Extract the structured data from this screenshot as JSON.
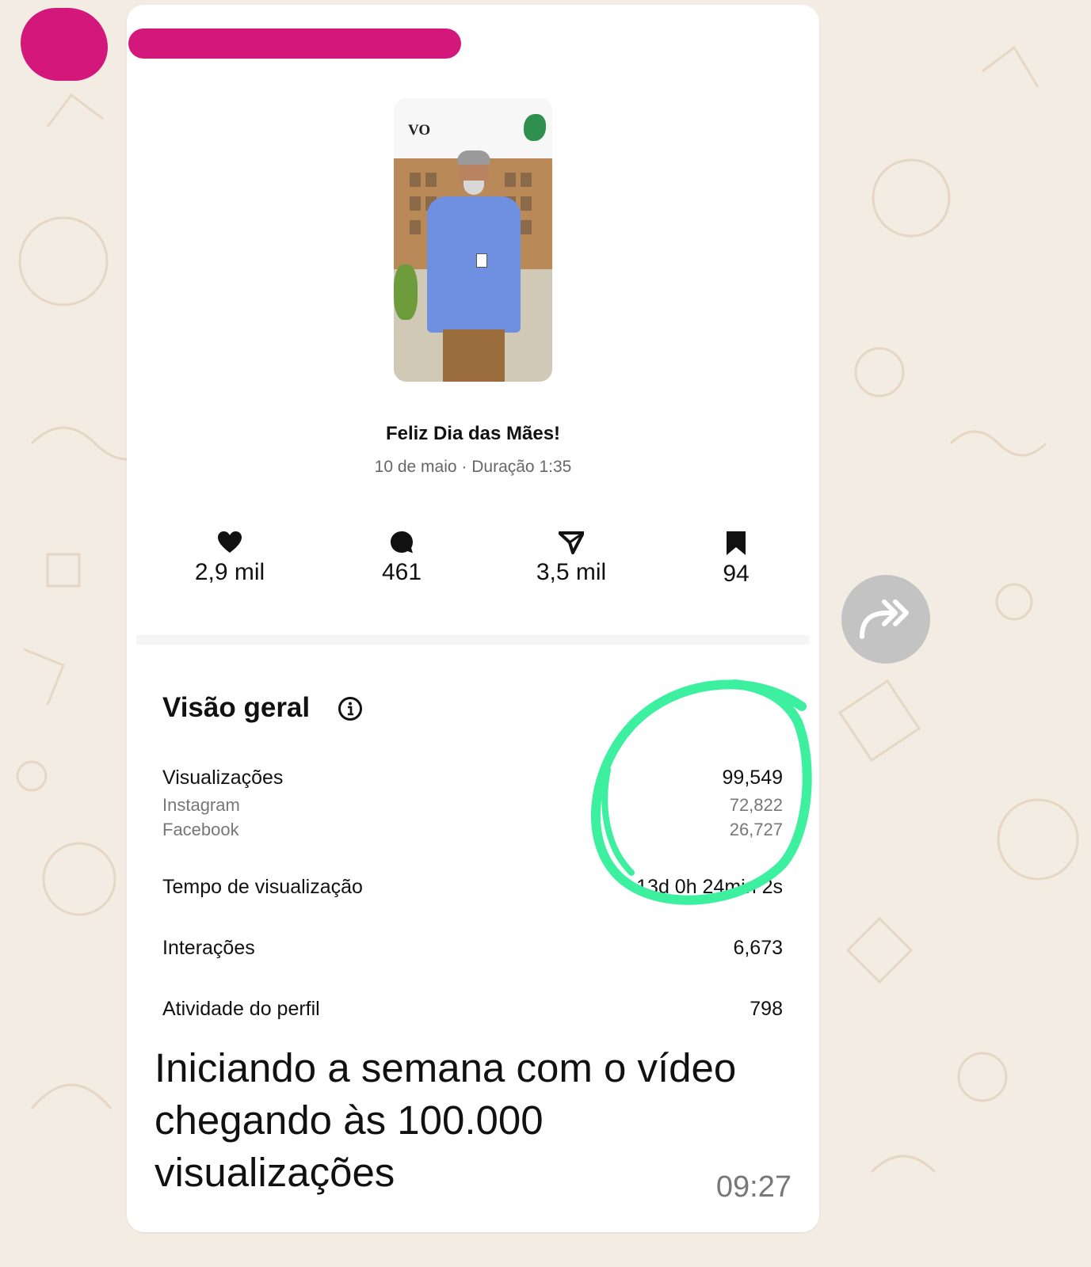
{
  "post": {
    "thumbnail_logo": "VO",
    "title": "Feliz Dia das Mães!",
    "subtitle": "10 de maio · Duração 1:35"
  },
  "metrics": [
    {
      "icon": "heart-icon",
      "value": "2,9 mil"
    },
    {
      "icon": "comment-icon",
      "value": "461"
    },
    {
      "icon": "share-icon",
      "value": "3,5 mil"
    },
    {
      "icon": "bookmark-icon",
      "value": "94"
    }
  ],
  "overview": {
    "title": "Visão geral",
    "views_label": "Visualizações",
    "views_value": "99,549",
    "instagram_label": "Instagram",
    "instagram_value": "72,822",
    "facebook_label": "Facebook",
    "facebook_value": "26,727",
    "watch_time_label": "Tempo de visualização",
    "watch_time_value": "13d 0h 24min 2s",
    "interactions_label": "Interações",
    "interactions_value": "6,673",
    "profile_activity_label": "Atividade do perfil",
    "profile_activity_value": "798"
  },
  "message": {
    "caption": "Iniciando a semana com o vídeo chegando às 100.000 visualizações",
    "time": "09:27"
  },
  "colors": {
    "wallpaper": "#f3ece3",
    "redaction": "#d4177a",
    "annotation_circle": "#3df0a0",
    "forward_button": "#c3c3c3"
  }
}
